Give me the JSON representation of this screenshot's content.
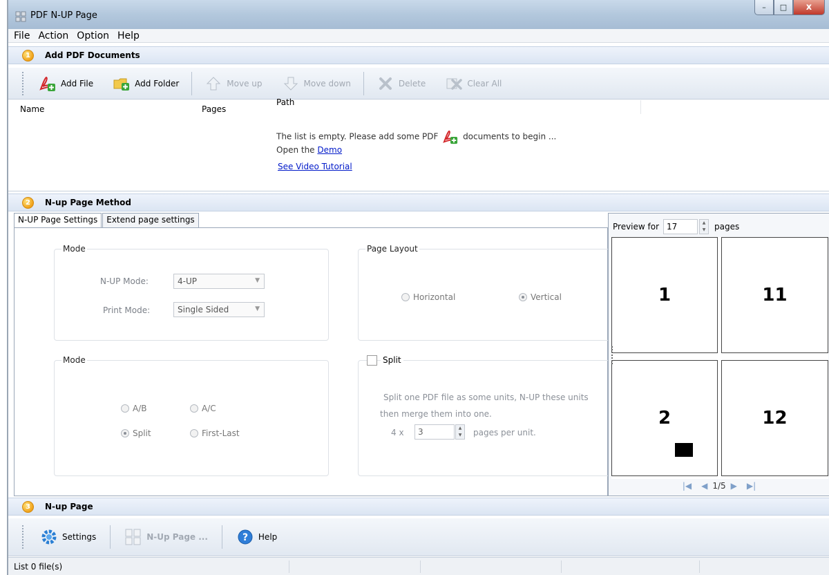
{
  "window": {
    "title": "PDF N-UP Page",
    "controls": {
      "minimize": "–",
      "maximize": "□",
      "close": "x"
    }
  },
  "menu": [
    "File",
    "Action",
    "Option",
    "Help"
  ],
  "section1": {
    "step": "1",
    "title": "Add PDF Documents"
  },
  "toolbar1": {
    "add_file": "Add File",
    "add_folder": "Add Folder",
    "move_up": "Move up",
    "move_down": "Move down",
    "delete": "Delete",
    "clear_all": "Clear All"
  },
  "filelist": {
    "columns": [
      "Name",
      "Pages",
      "Path"
    ],
    "empty_text_before": "The list is empty. Please add some PDF",
    "empty_text_after": "documents to begin ...",
    "open_the": "Open the",
    "demo_link": "Demo",
    "video_link": "See Video Tutorial"
  },
  "section2": {
    "step": "2",
    "title": "N-up Page Method"
  },
  "tabs": [
    "N-UP Page Settings",
    "Extend page settings"
  ],
  "mode_group": {
    "label": "Mode",
    "nup_mode_label": "N-UP Mode:",
    "nup_mode_value": "4-UP",
    "print_mode_label": "Print Mode:",
    "print_mode_value": "Single Sided"
  },
  "layout_group": {
    "label": "Page Layout",
    "horizontal": "Horizontal",
    "vertical": "Vertical",
    "selected": "vertical"
  },
  "mode2_group": {
    "label": "Mode",
    "ab": "A/B",
    "ac": "A/C",
    "split": "Split",
    "first_last": "First-Last",
    "selected": "split"
  },
  "split_group": {
    "label": "Split",
    "checked": false,
    "desc_line1": "Split one PDF file as some units, N-UP these units",
    "desc_line2": "then merge them into one.",
    "multiplier": "4 x",
    "units_value": "3",
    "units_suffix": "pages per unit."
  },
  "preview": {
    "label": "Preview for",
    "count": "17",
    "suffix": "pages",
    "cells": [
      "1",
      "11",
      "2",
      "12"
    ],
    "page_indicator": "1/5"
  },
  "section3": {
    "step": "3",
    "title": "N-up Page"
  },
  "toolbar3": {
    "settings": "Settings",
    "nup_page": "N-Up Page ...",
    "help": "Help"
  },
  "status": {
    "text": "List 0 file(s)"
  }
}
